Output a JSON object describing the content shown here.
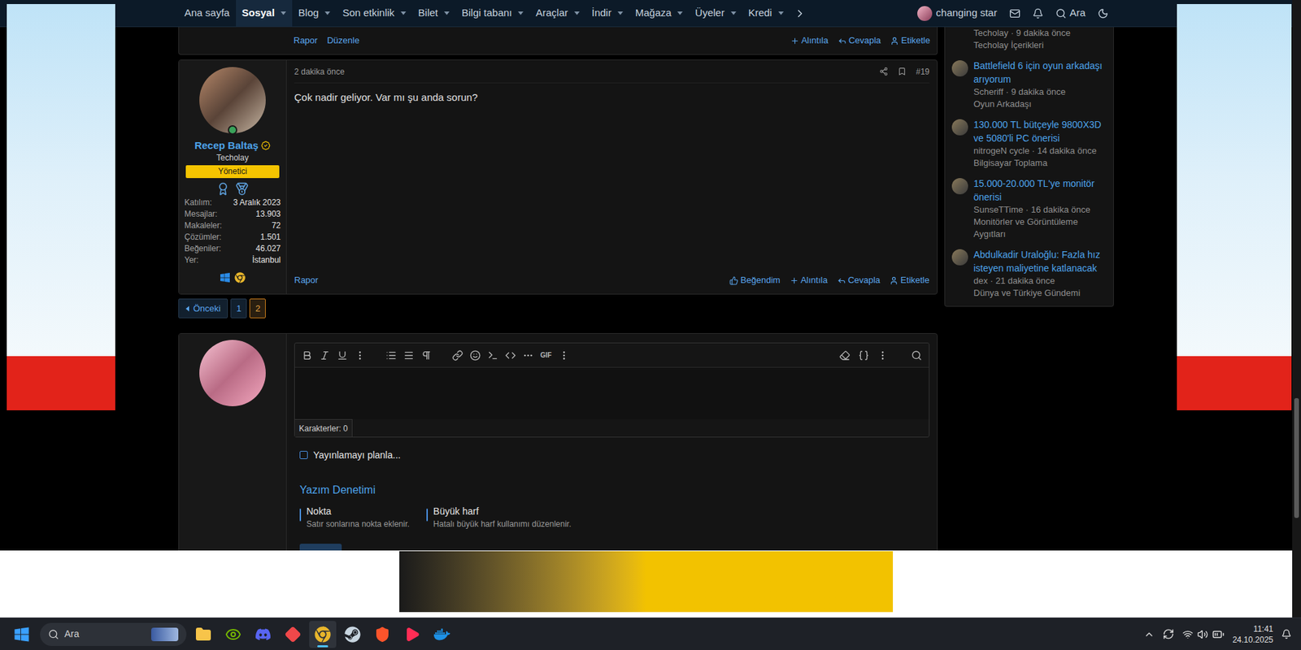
{
  "nav": {
    "items": [
      {
        "label": "Ana sayfa",
        "selected": false,
        "dropdown": false
      },
      {
        "label": "Sosyal",
        "selected": true,
        "dropdown": true
      },
      {
        "label": "Blog",
        "selected": false,
        "dropdown": true
      },
      {
        "label": "Son etkinlik",
        "selected": false,
        "dropdown": true
      },
      {
        "label": "Bilet",
        "selected": false,
        "dropdown": true
      },
      {
        "label": "Bilgi tabanı",
        "selected": false,
        "dropdown": true
      },
      {
        "label": "Araçlar",
        "selected": false,
        "dropdown": true
      },
      {
        "label": "İndir",
        "selected": false,
        "dropdown": true
      },
      {
        "label": "Mağaza",
        "selected": false,
        "dropdown": true
      },
      {
        "label": "Üyeler",
        "selected": false,
        "dropdown": true
      },
      {
        "label": "Kredi",
        "selected": false,
        "dropdown": true
      }
    ],
    "user": "changing star",
    "search": "Ara"
  },
  "previous_post_footer": {
    "links": [
      "Rapor",
      "Düzenle"
    ],
    "actions": [
      {
        "label": "Alıntıla",
        "kind": "quote"
      },
      {
        "label": "Cevapla",
        "kind": "reply"
      },
      {
        "label": "Etiketle",
        "kind": "tag"
      }
    ]
  },
  "post": {
    "time": "2 dakika önce",
    "number": "#19",
    "author": {
      "name": "Recep Baltaş",
      "verified": true,
      "online": true,
      "title": "Techolay",
      "role": "Yönetici",
      "stats": [
        {
          "label": "Katılım:",
          "value": "3 Aralık 2023"
        },
        {
          "label": "Mesajlar:",
          "value": "13.903"
        },
        {
          "label": "Makaleler:",
          "value": "72"
        },
        {
          "label": "Çözümler:",
          "value": "1.501"
        },
        {
          "label": "Beğeniler:",
          "value": "46.027"
        },
        {
          "label": "Yer:",
          "value": "İstanbul"
        }
      ]
    },
    "message": "Çok nadir geliyor. Var mı şu anda sorun?",
    "report": "Rapor",
    "actions": [
      {
        "label": "Beğendim",
        "kind": "like"
      },
      {
        "label": "Alıntıla",
        "kind": "quote"
      },
      {
        "label": "Cevapla",
        "kind": "reply"
      },
      {
        "label": "Etiketle",
        "kind": "tag"
      }
    ]
  },
  "pagination": {
    "previous": "Önceki",
    "pages": [
      {
        "label": "1",
        "selected": false
      },
      {
        "label": "2",
        "selected": true
      }
    ]
  },
  "reply": {
    "toolbar_gif": "GIF",
    "characters": "Karakterler: 0",
    "schedule": {
      "label": "Yayınlamayı planla...",
      "checked": false
    },
    "spellcheck": {
      "title": "Yazım Denetimi",
      "options": [
        {
          "label": "Nokta",
          "description": "Satır sonlarına nokta eklenir.",
          "checked": false
        },
        {
          "label": "Büyük harf",
          "description": "Hatalı büyük harf kullanımı düzenlenir.",
          "checked": false
        }
      ]
    }
  },
  "sidebar": {
    "items": [
      {
        "partial": true,
        "meta": "Techolay · 9 dakika önce",
        "category": "Techolay İçerikleri"
      },
      {
        "partial": false,
        "title": "Battlefield 6 için oyun arkadaşı arıyorum",
        "meta": "Scheriff · 9 dakika önce",
        "category": "Oyun Arkadaşı"
      },
      {
        "partial": false,
        "title": "130.000 TL bütçeyle 9800X3D ve 5080'li PC önerisi",
        "meta": "nitrogeN cycle · 14 dakika önce",
        "category": "Bilgisayar Toplama"
      },
      {
        "partial": false,
        "title": "15.000-20.000 TL'ye monitör önerisi",
        "meta": "SunseTTime · 16 dakika önce",
        "category": "Monitörler ve Görüntüleme Aygıtları"
      },
      {
        "partial": false,
        "title": "Abdulkadir Uraloğlu: Fazla hız isteyen maliyetine katlanacak",
        "meta": "dex · 21 dakika önce",
        "category": "Dünya ve Türkiye Gündemi"
      }
    ]
  },
  "taskbar": {
    "search": "Ara",
    "apps": [
      {
        "kind": "explorer",
        "active": false
      },
      {
        "kind": "nvidia",
        "active": false
      },
      {
        "kind": "discord",
        "active": false
      },
      {
        "kind": "diamond",
        "active": false
      },
      {
        "kind": "chrome",
        "active": true
      },
      {
        "kind": "steam",
        "active": false
      },
      {
        "kind": "brave",
        "active": false
      },
      {
        "kind": "player",
        "active": false
      },
      {
        "kind": "docker",
        "active": false
      }
    ],
    "time": "11:41",
    "date": "24.10.2025"
  }
}
